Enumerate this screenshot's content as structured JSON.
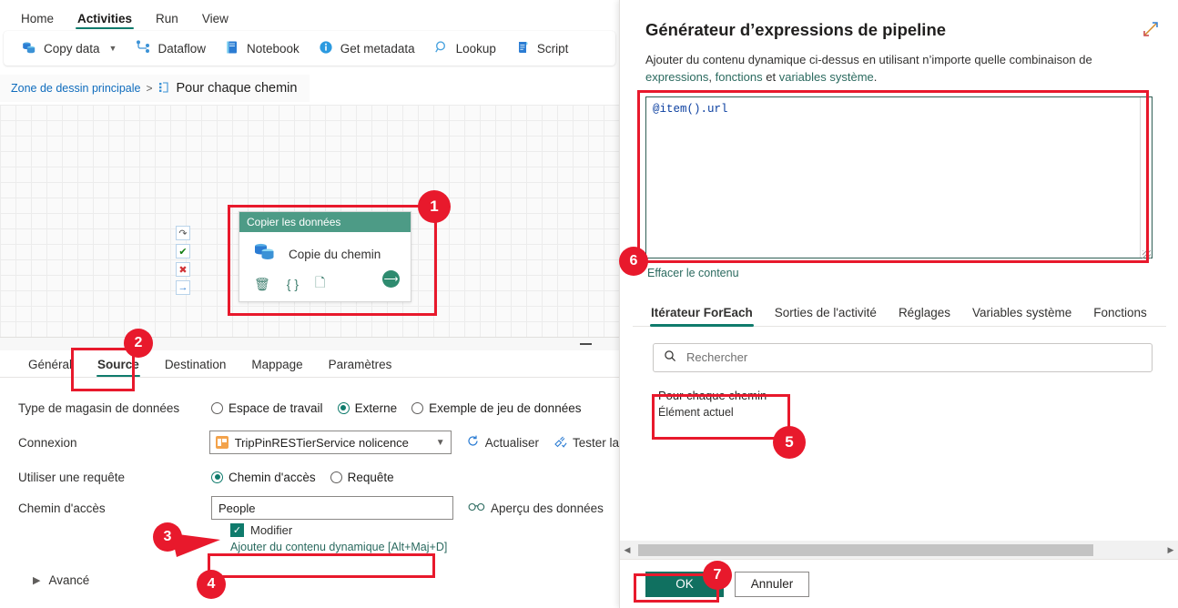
{
  "ribbon": {
    "tabs": [
      {
        "label": "Home",
        "active": false
      },
      {
        "label": "Activities",
        "active": true
      },
      {
        "label": "Run",
        "active": false
      },
      {
        "label": "View",
        "active": false
      }
    ]
  },
  "toolbar": {
    "items": [
      {
        "label": "Copy data",
        "icon": "copy-data-icon",
        "has_chevron": true
      },
      {
        "label": "Dataflow",
        "icon": "dataflow-icon",
        "has_chevron": false
      },
      {
        "label": "Notebook",
        "icon": "notebook-icon",
        "has_chevron": false
      },
      {
        "label": "Get metadata",
        "icon": "info-icon",
        "has_chevron": false
      },
      {
        "label": "Lookup",
        "icon": "magnifier-icon",
        "has_chevron": false
      },
      {
        "label": "Script",
        "icon": "script-icon",
        "has_chevron": false
      }
    ]
  },
  "breadcrumb": {
    "root": "Zone de dessin principale",
    "separator": ">",
    "current": "Pour chaque chemin",
    "current_icon": "foreach-icon"
  },
  "canvas": {
    "activity": {
      "header": "Copier les données",
      "name": "Copie du chemin",
      "icon": "database-copy-icon",
      "footer_icons": [
        "delete-icon",
        "code-braces-icon",
        "clone-icon",
        "run-arrow-icon"
      ],
      "ports": [
        {
          "name": "skip-port",
          "glyph": "↷"
        },
        {
          "name": "success-port",
          "glyph": "✔"
        },
        {
          "name": "failure-port",
          "glyph": "✖"
        },
        {
          "name": "completion-port",
          "glyph": "→"
        }
      ]
    }
  },
  "properties": {
    "tabs": [
      {
        "label": "Général",
        "active": false
      },
      {
        "label": "Source",
        "active": true
      },
      {
        "label": "Destination",
        "active": false
      },
      {
        "label": "Mappage",
        "active": false
      },
      {
        "label": "Paramètres",
        "active": false
      }
    ],
    "rows": {
      "store_type": {
        "label": "Type de magasin de données",
        "options": [
          {
            "label": "Espace de travail",
            "selected": false
          },
          {
            "label": "Externe",
            "selected": true
          },
          {
            "label": "Exemple de jeu de données",
            "selected": false
          }
        ]
      },
      "connection": {
        "label": "Connexion",
        "value": "TripPinRESTierService nolicence",
        "refresh_label": "Actualiser",
        "test_label": "Tester la"
      },
      "use_query": {
        "label": "Utiliser une requête",
        "options": [
          {
            "label": "Chemin d'accès",
            "selected": true
          },
          {
            "label": "Requête",
            "selected": false
          }
        ]
      },
      "path": {
        "label": "Chemin d'accès",
        "value": "People",
        "placeholder": "",
        "preview_label": "Aperçu des données",
        "checkbox_label": "Modifier",
        "checkbox_checked": true,
        "dynamic_link": "Ajouter du contenu dynamique [Alt+Maj+D]"
      },
      "advanced": {
        "label": "Avancé"
      }
    }
  },
  "panel": {
    "title": "Générateur d’expressions de pipeline",
    "expand_icon": "expand-diagonal-icon",
    "description_parts": [
      {
        "text": "Ajouter du contenu dynamique ci-dessus en utilisant n’importe quelle combinaison de ",
        "link": false
      },
      {
        "text": "expressions",
        "link": true
      },
      {
        "text": ", ",
        "link": false
      },
      {
        "text": "fonctions",
        "link": true
      },
      {
        "text": " et ",
        "link": false
      },
      {
        "text": "variables système",
        "link": true
      },
      {
        "text": ".",
        "link": false
      }
    ],
    "expression": "@item().url",
    "clear_label": "Effacer le contenu",
    "tabs": [
      {
        "label": "Itérateur ForEach",
        "active": true
      },
      {
        "label": "Sorties de l'activité",
        "active": false
      },
      {
        "label": "Réglages",
        "active": false
      },
      {
        "label": "Variables système",
        "active": false
      },
      {
        "label": "Fonctions",
        "active": false
      }
    ],
    "search_placeholder": "Rechercher",
    "search_value": "",
    "items": [
      {
        "title": "Pour chaque chemin",
        "subtitle": "Élément actuel"
      }
    ],
    "buttons": {
      "ok": "OK",
      "cancel": "Annuler"
    }
  },
  "annotations": {
    "color": "#e8192c",
    "steps": [
      {
        "number": "1"
      },
      {
        "number": "2"
      },
      {
        "number": "3"
      },
      {
        "number": "4"
      },
      {
        "number": "5"
      },
      {
        "number": "6"
      },
      {
        "number": "7"
      }
    ]
  },
  "colors": {
    "accent_teal": "#0f7b6c",
    "activity_header": "#4d9b86",
    "ok_button": "#107060",
    "annotation_red": "#e8192c",
    "link_blue": "#0f6cbd"
  }
}
